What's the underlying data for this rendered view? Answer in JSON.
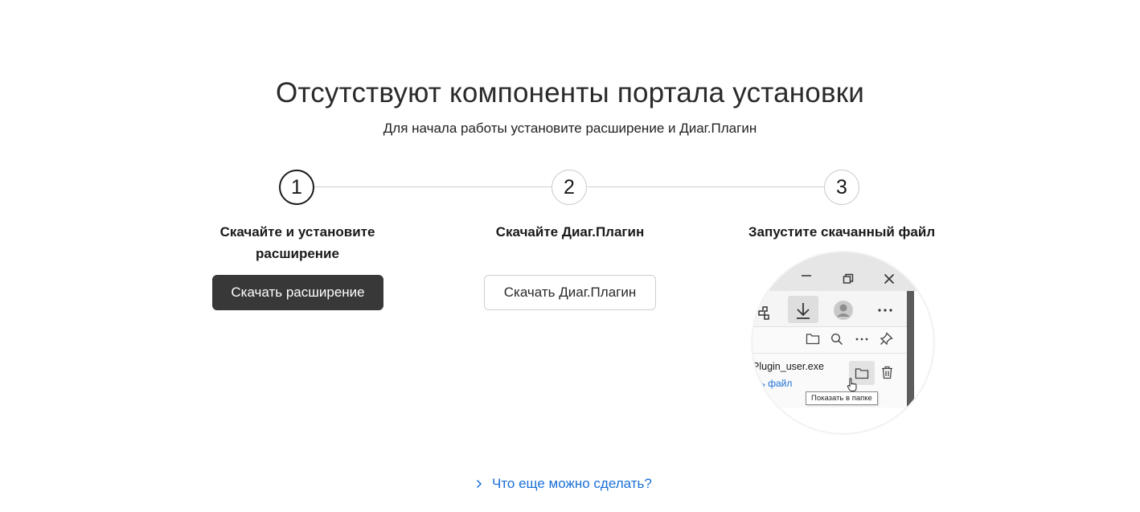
{
  "header": {
    "title": "Отсутствуют компоненты портала установки",
    "subtitle": "Для начала работы установите расширение и Диаг.Плагин"
  },
  "steps": [
    {
      "number": "1",
      "label_line1": "Скачайте и установите",
      "label_line2": "расширение",
      "button": "Скачать расширение"
    },
    {
      "number": "2",
      "label_line1": "Скачайте Диаг.Плагин",
      "button": "Скачать Диаг.Плагин"
    },
    {
      "number": "3",
      "label_line1": "Запустите скачанный файл"
    }
  ],
  "illustration": {
    "filename": "Plugin_user.exe",
    "link": "ть файл",
    "tooltip": "Показать в папке",
    "icons": [
      "minimize-icon",
      "restore-icon",
      "close-icon",
      "extensions-icon",
      "download-icon",
      "profile-icon",
      "more-icon",
      "folder-icon",
      "search-icon",
      "more-icon",
      "pin-icon",
      "folder-icon",
      "trash-icon",
      "cursor-icon"
    ]
  },
  "footer": {
    "more_link": "Что еще можно сделать?"
  },
  "colors": {
    "primary_button": "#383838",
    "link": "#1a6fd6",
    "step_line": "#cfcfcf"
  }
}
